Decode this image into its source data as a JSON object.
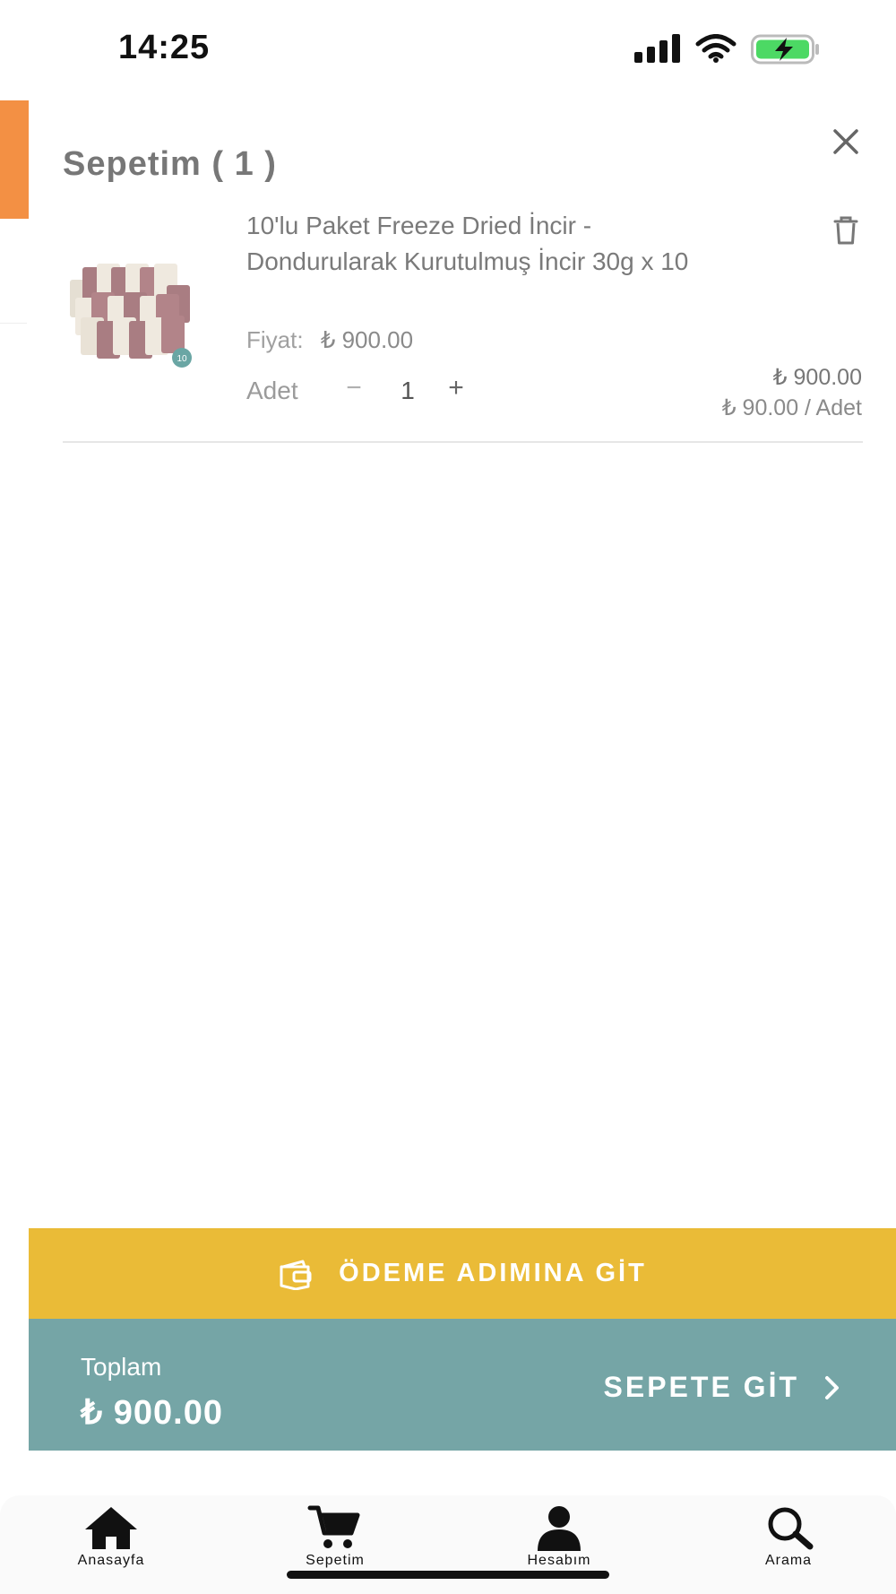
{
  "status_bar": {
    "time": "14:25"
  },
  "cart": {
    "title": "Sepetim ( 1 )",
    "item": {
      "name": "10'lu Paket Freeze Dried İncir - Dondurularak Kurutulmuş İncir 30g x 10",
      "price_label": "Fiyat:",
      "price": "₺ 900.00",
      "qty_label": "Adet",
      "qty_minus": "−",
      "qty_value": "1",
      "qty_plus": "+",
      "line_total": "₺ 900.00",
      "unit_price": "₺ 90.00 / Adet",
      "image_badge": "10"
    }
  },
  "checkout": {
    "label": "ÖDEME ADIMINA GİT"
  },
  "summary": {
    "total_label": "Toplam",
    "total_value": "₺ 900.00",
    "go_cart_label": "SEPETE GİT"
  },
  "tab_bar": {
    "items": [
      {
        "label": "Anasayfa",
        "icon": "home-icon"
      },
      {
        "label": "Sepetim",
        "icon": "cart-icon"
      },
      {
        "label": "Hesabım",
        "icon": "person-icon"
      },
      {
        "label": "Arama",
        "icon": "search-icon"
      }
    ]
  },
  "colors": {
    "accent_orange": "#f39044",
    "checkout_yellow": "#eabb37",
    "total_teal": "#75a5a6"
  }
}
